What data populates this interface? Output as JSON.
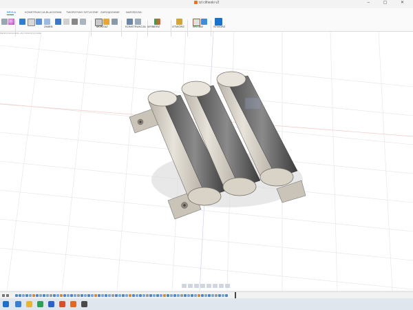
{
  "window": {
    "title": "rzl cliheski v2",
    "controls": "– ▢ ✕"
  },
  "ribbon": {
    "tabs": [
      "BRYŁA",
      "KONSTRUKCJA BLACHOWA",
      "TWORZYWO SZTUCZNE",
      "ZARZĄDZANIE",
      "NARZĘDZIA"
    ],
    "active_tab": "BRYŁA",
    "groups": [
      "ZMIEŃ",
      "KONSTRUKCJA",
      "WYBIERZ",
      "MONTAŻ",
      "OTWÓRZ",
      "STWÓRZ",
      "WSTAW"
    ]
  },
  "side_hint": "Zamknij komponentę, aby zobaczyć gryzacje",
  "accent_color": "#1a73c9",
  "timeline": {
    "marker": "play-position"
  }
}
